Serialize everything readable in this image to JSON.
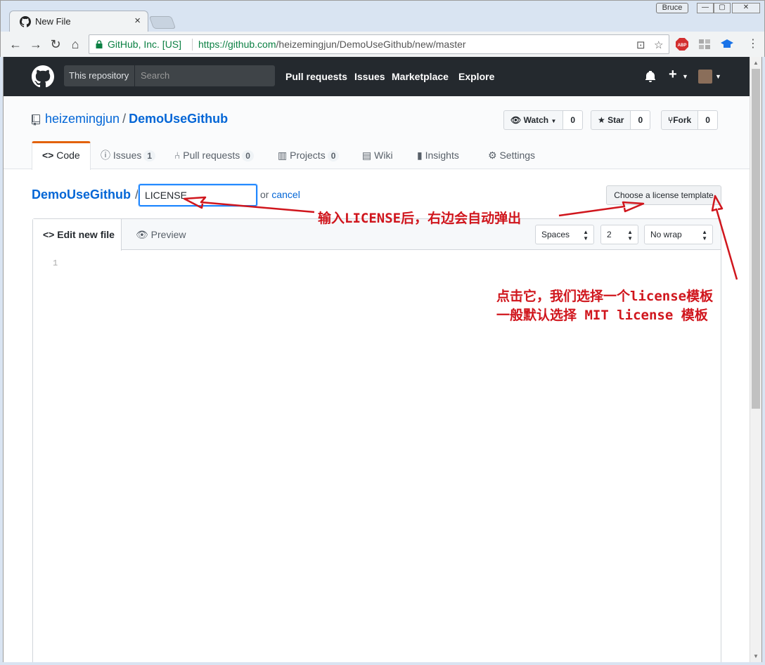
{
  "browser": {
    "tab_title": "New File",
    "tab_close": "×",
    "profile_name": "Bruce",
    "controls": {
      "minimize": "—",
      "maximize": "▢",
      "close": "✕"
    },
    "site_identity": "GitHub, Inc. [US]",
    "url_scheme_host": "https://github.com",
    "url_path": "/heizemingjun/DemoUseGithub/new/master",
    "ext_abp": "ABP"
  },
  "header": {
    "search_scope": "This repository",
    "search_placeholder": "Search",
    "nav": [
      "Pull requests",
      "Issues",
      "Marketplace",
      "Explore"
    ],
    "plus": "+"
  },
  "repo": {
    "owner": "heizemingjun",
    "separator": "/",
    "name": "DemoUseGithub",
    "watch_label": "Watch",
    "watch_count": "0",
    "star_label": "Star",
    "star_count": "0",
    "fork_label": "Fork",
    "fork_count": "0",
    "tabs": [
      {
        "label": "Code",
        "icon": "code-icon"
      },
      {
        "label": "Issues",
        "count": "1",
        "icon": "issue-icon"
      },
      {
        "label": "Pull requests",
        "count": "0",
        "icon": "pull-request-icon"
      },
      {
        "label": "Projects",
        "count": "0",
        "icon": "project-icon"
      },
      {
        "label": "Wiki",
        "icon": "book-icon"
      },
      {
        "label": "Insights",
        "icon": "graph-icon"
      },
      {
        "label": "Settings",
        "icon": "gear-icon"
      }
    ]
  },
  "editor": {
    "breadcrumb_repo": "DemoUseGithub",
    "breadcrumb_sep": "/",
    "filename_value": "LICENSE",
    "or_text": "or",
    "cancel_label": "cancel",
    "license_button": "Choose a license template",
    "tab_edit": "Edit new file",
    "tab_preview": "Preview",
    "indent_mode": "Spaces",
    "indent_size": "2",
    "wrap_mode": "No wrap",
    "line_number": "1"
  },
  "annotations": {
    "note1": "输入LICENSE后，右边会自动弹出",
    "note2_line1": "点击它，我们选择一个license模板",
    "note2_line2": "一般默认选择 MIT license 模板",
    "color": "#d0161d"
  }
}
